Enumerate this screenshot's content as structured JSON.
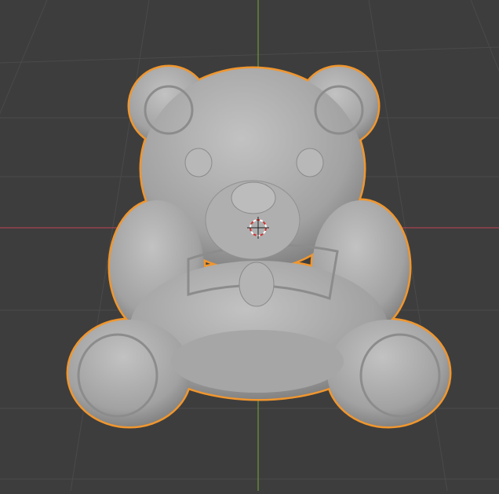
{
  "viewport": {
    "mode": "3d-viewport",
    "selected_object": "teddy-bear-mesh",
    "colors": {
      "background": "#3d3d3d",
      "grid": "#4a4a4a",
      "x_axis": "#a8434f",
      "y_axis": "#6a9a3a",
      "selection_outline": "#f0962e",
      "mesh": "#a9a9a9"
    },
    "icons": {
      "cursor": "3d-cursor-icon"
    }
  }
}
